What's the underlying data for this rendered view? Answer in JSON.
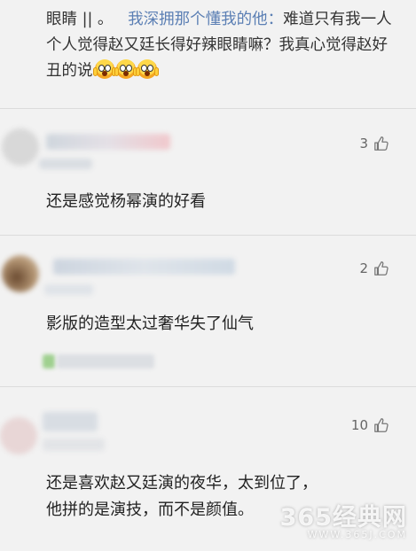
{
  "reply": {
    "prefix": "眼睛 || 。",
    "mention": "我深拥那个懂我的他：",
    "text": "难道只有我一人个人觉得赵又廷长得好辣眼睛嘛？我真心觉得赵好丑的说",
    "emojis": [
      "scream-emoji",
      "scream-emoji",
      "scream-emoji"
    ]
  },
  "comments": [
    {
      "text": "还是感觉杨幂演的好看",
      "likes": "3"
    },
    {
      "text": "影版的造型太过奢华失了仙气",
      "likes": "2"
    },
    {
      "text_line1": "还是喜欢赵又廷演的夜华，太到位了，",
      "text_line2": "他拼的是演技，而不是颜值。",
      "likes": "10"
    }
  ],
  "watermark": {
    "main": "365经典网",
    "sub": "WWW.365J.COM"
  },
  "colors": {
    "mention": "#5b7fb4",
    "background": "#f2f2f2",
    "divider": "#dcdcdc"
  }
}
